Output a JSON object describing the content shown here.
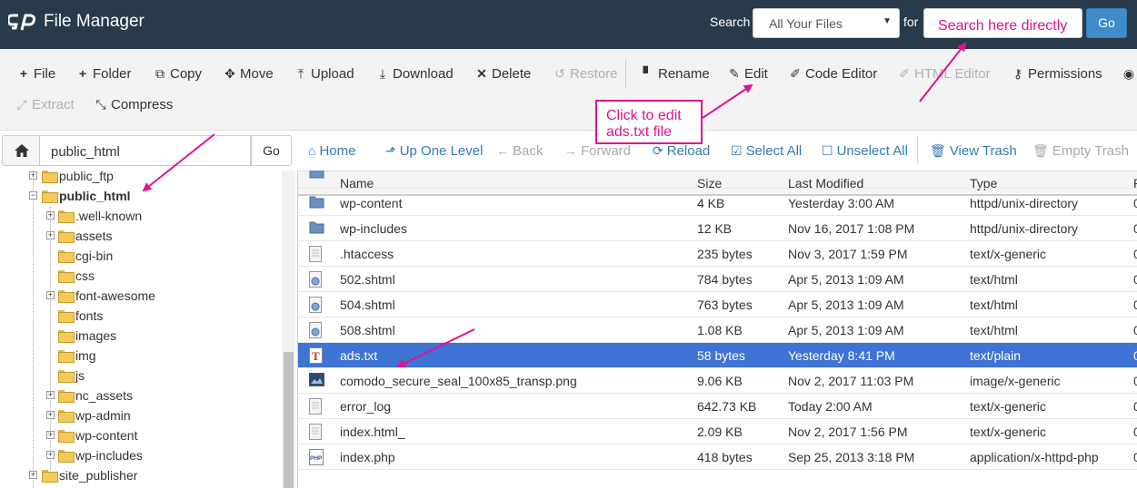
{
  "topbar": {
    "title": "File Manager",
    "search_label": "Search",
    "search_scope": "All Your Files",
    "for_label": "for",
    "search_placeholder": "Search here directly",
    "go_label": "Go"
  },
  "toolbar": {
    "file": "File",
    "folder": "Folder",
    "copy": "Copy",
    "move": "Move",
    "upload": "Upload",
    "download": "Download",
    "delete": "Delete",
    "restore": "Restore",
    "rename": "Rename",
    "edit": "Edit",
    "code_editor": "Code Editor",
    "html_editor": "HTML Editor",
    "permissions": "Permissions",
    "extract": "Extract",
    "compress": "Compress"
  },
  "pathbar": {
    "path": "public_html",
    "go_label": "Go"
  },
  "nav": {
    "home": "Home",
    "up_one_level": "Up One Level",
    "back": "Back",
    "forward": "Forward",
    "reload": "Reload",
    "select_all": "Select All",
    "unselect_all": "Unselect All",
    "view_trash": "View Trash",
    "empty_trash": "Empty Trash"
  },
  "tree": {
    "items": [
      {
        "label": "public_ftp"
      },
      {
        "label": "public_html"
      },
      {
        "label": ".well-known"
      },
      {
        "label": "assets"
      },
      {
        "label": "cgi-bin"
      },
      {
        "label": "css"
      },
      {
        "label": "font-awesome"
      },
      {
        "label": "fonts"
      },
      {
        "label": "images"
      },
      {
        "label": "img"
      },
      {
        "label": "js"
      },
      {
        "label": "nc_assets"
      },
      {
        "label": "wp-admin"
      },
      {
        "label": "wp-content"
      },
      {
        "label": "wp-includes"
      },
      {
        "label": "site_publisher"
      }
    ]
  },
  "table": {
    "headers": {
      "name": "Name",
      "size": "Size",
      "modified": "Last Modified",
      "type": "Type",
      "perms": "P"
    },
    "rows": [
      {
        "name": "wp-content",
        "size": "4 KB",
        "modified": "Yesterday 3:00 AM",
        "type": "httpd/unix-directory",
        "perm": "0",
        "icon": "folder-icon"
      },
      {
        "name": "wp-includes",
        "size": "12 KB",
        "modified": "Nov 16, 2017 1:08 PM",
        "type": "httpd/unix-directory",
        "perm": "0",
        "icon": "folder-icon"
      },
      {
        "name": ".htaccess",
        "size": "235 bytes",
        "modified": "Nov 3, 2017 1:59 PM",
        "type": "text/x-generic",
        "perm": "0",
        "icon": "text-file-icon"
      },
      {
        "name": "502.shtml",
        "size": "784 bytes",
        "modified": "Apr 5, 2013 1:09 AM",
        "type": "text/html",
        "perm": "0",
        "icon": "html-file-icon"
      },
      {
        "name": "504.shtml",
        "size": "763 bytes",
        "modified": "Apr 5, 2013 1:09 AM",
        "type": "text/html",
        "perm": "0",
        "icon": "html-file-icon"
      },
      {
        "name": "508.shtml",
        "size": "1.08 KB",
        "modified": "Apr 5, 2013 1:09 AM",
        "type": "text/html",
        "perm": "0",
        "icon": "html-file-icon"
      },
      {
        "name": "ads.txt",
        "size": "58 bytes",
        "modified": "Yesterday 8:41 PM",
        "type": "text/plain",
        "perm": "0",
        "icon": "plain-text-icon"
      },
      {
        "name": "comodo_secure_seal_100x85_transp.png",
        "size": "9.06 KB",
        "modified": "Nov 2, 2017 11:03 PM",
        "type": "image/x-generic",
        "perm": "0",
        "icon": "image-file-icon"
      },
      {
        "name": "error_log",
        "size": "642.73 KB",
        "modified": "Today 2:00 AM",
        "type": "text/x-generic",
        "perm": "0",
        "icon": "text-file-icon"
      },
      {
        "name": "index.html_",
        "size": "2.09 KB",
        "modified": "Nov 2, 2017 1:56 PM",
        "type": "text/x-generic",
        "perm": "0",
        "icon": "text-file-icon"
      },
      {
        "name": "index.php",
        "size": "418 bytes",
        "modified": "Sep 25, 2013 3:18 PM",
        "type": "application/x-httpd-php",
        "perm": "0",
        "icon": "php-file-icon"
      }
    ]
  },
  "annotation": {
    "callout_line1": "Click to edit",
    "callout_line2": "ads.txt file"
  },
  "colors": {
    "topbar": "#293a4a",
    "accent_blue": "#428bca",
    "selected_row": "#3f74d4",
    "annotation_pink": "#e0138c"
  }
}
